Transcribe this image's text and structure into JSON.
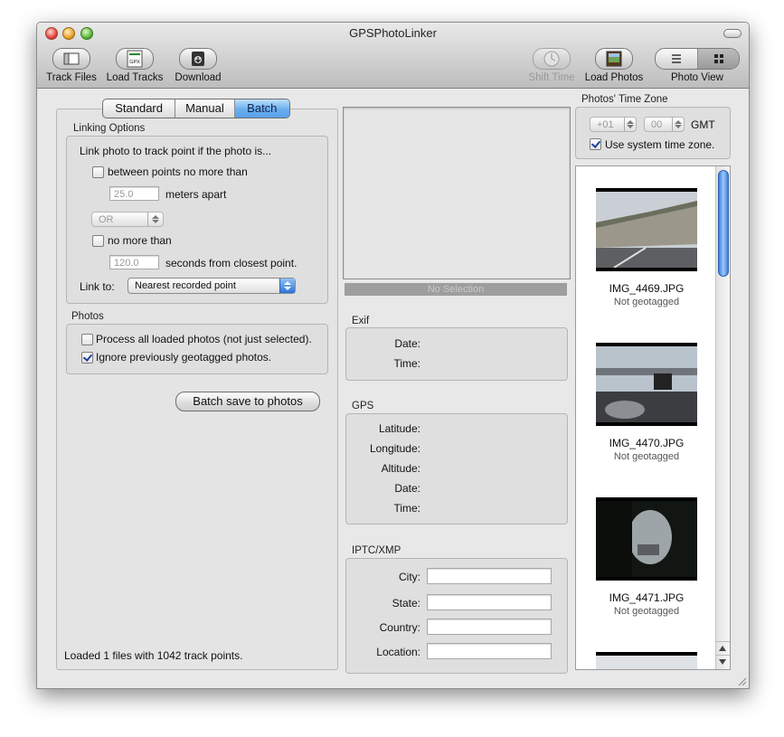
{
  "window": {
    "title": "GPSPhotoLinker"
  },
  "toolbar": {
    "track_files": "Track Files",
    "load_tracks": "Load Tracks",
    "gpx_badge": "GPX",
    "download": "Download",
    "shift_time": "Shift Time",
    "load_photos": "Load Photos",
    "photo_view": "Photo View"
  },
  "tabs": {
    "standard": "Standard",
    "manual": "Manual",
    "batch": "Batch",
    "selected": "Batch"
  },
  "linking": {
    "title": "Linking Options",
    "intro": "Link photo to track point if the photo is...",
    "between_label": "between points no more than",
    "between_checked": false,
    "meters_value": "25.0",
    "meters_suffix": "meters apart",
    "or_value": "OR",
    "no_more_label": "no more than",
    "no_more_checked": false,
    "seconds_value": "120.0",
    "seconds_suffix": "seconds from closest point.",
    "link_to_label": "Link to:",
    "link_to_value": "Nearest recorded point"
  },
  "photos": {
    "title": "Photos",
    "process_all": "Process all loaded photos (not just selected).",
    "process_all_checked": false,
    "ignore_geotagged": "Ignore previously geotagged photos.",
    "ignore_geotagged_checked": true,
    "batch_save": "Batch save to photos"
  },
  "status": "Loaded 1 files with 1042 track points.",
  "details": {
    "no_selection": "No Selection",
    "exif_title": "Exif",
    "exif_date": "Date:",
    "exif_time": "Time:",
    "gps_title": "GPS",
    "latitude": "Latitude:",
    "longitude": "Longitude:",
    "altitude": "Altitude:",
    "gps_date": "Date:",
    "gps_time": "Time:",
    "iptc_title": "IPTC/XMP",
    "city": "City:",
    "state": "State:",
    "country": "Country:",
    "location": "Location:"
  },
  "timezone": {
    "title": "Photos' Time Zone",
    "hours": "+01",
    "minutes": "00",
    "gmt": "GMT",
    "use_system": "Use system time zone.",
    "use_system_checked": true
  },
  "photo_list": [
    {
      "name": "IMG_4469.JPG",
      "status": "Not geotagged"
    },
    {
      "name": "IMG_4470.JPG",
      "status": "Not geotagged"
    },
    {
      "name": "IMG_4471.JPG",
      "status": "Not geotagged"
    }
  ],
  "colors": {
    "selected_tab": "#6aaef0",
    "no_selection_bar": "#9e9e9e"
  },
  "icons": [
    "track-files-icon",
    "gpx-file-icon",
    "download-icon",
    "clock-icon",
    "photo-album-icon",
    "list-view-icon",
    "grid-view-icon"
  ]
}
